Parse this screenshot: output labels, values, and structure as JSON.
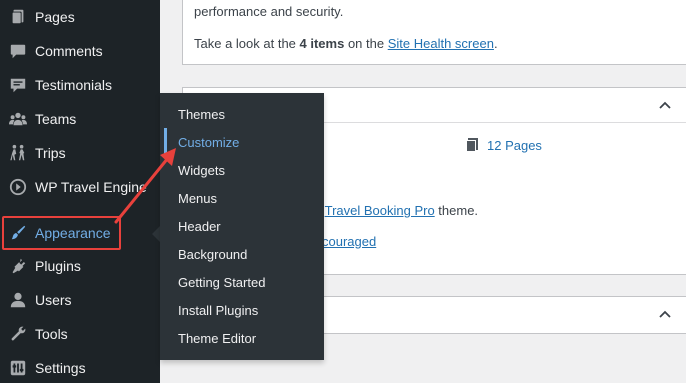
{
  "sidebar": {
    "items": [
      {
        "label": "Pages",
        "icon": "pages-icon"
      },
      {
        "label": "Comments",
        "icon": "comments-icon"
      },
      {
        "label": "Testimonials",
        "icon": "testimonials-icon"
      },
      {
        "label": "Teams",
        "icon": "teams-icon"
      },
      {
        "label": "Trips",
        "icon": "trips-icon"
      },
      {
        "label": "WP Travel Engine",
        "icon": "wp-travel-engine-icon"
      },
      {
        "label": "Appearance",
        "icon": "appearance-brush-icon",
        "active": true
      },
      {
        "label": "Plugins",
        "icon": "plugins-icon"
      },
      {
        "label": "Users",
        "icon": "users-icon"
      },
      {
        "label": "Tools",
        "icon": "tools-icon"
      },
      {
        "label": "Settings",
        "icon": "settings-icon"
      }
    ]
  },
  "flyout": {
    "items": [
      "Themes",
      "Customize",
      "Widgets",
      "Menus",
      "Header",
      "Background",
      "Getting Started",
      "Install Plugins",
      "Theme Editor"
    ],
    "current": "Customize"
  },
  "site_health": {
    "line1": "performance and security.",
    "take_a_look": "Take a look at the ",
    "items_count": "4 items",
    "on_the": " on the ",
    "link": "Site Health screen",
    "period": "."
  },
  "at_a_glance": {
    "pages": "12 Pages",
    "theme_prefix": "g ",
    "theme_link": "Travel Booking Pro",
    "theme_suffix": " theme.",
    "discouraged": "couraged"
  },
  "colors": {
    "sidebar_bg": "#1d2327",
    "flyout_bg": "#2c3338",
    "accent": "#72aee6",
    "link": "#2271b1",
    "annotation": "#e8413c"
  }
}
